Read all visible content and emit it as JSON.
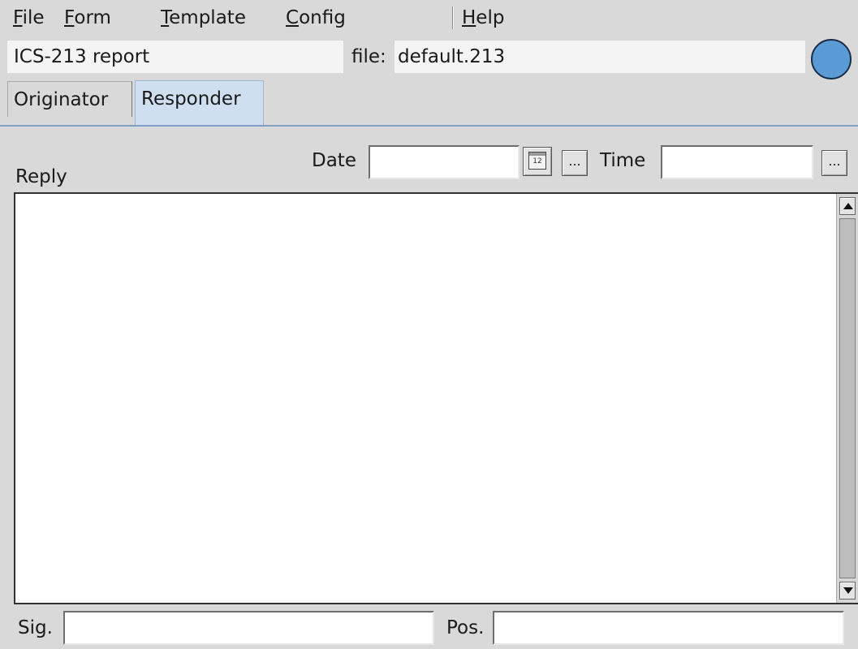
{
  "menu": {
    "file": {
      "underline": "F",
      "rest": "ile"
    },
    "form": {
      "underline": "F",
      "rest": "orm"
    },
    "template": {
      "underline": "T",
      "rest": "emplate"
    },
    "config": {
      "underline": "C",
      "rest": "onfig"
    },
    "help": {
      "underline": "H",
      "rest": "elp"
    }
  },
  "header": {
    "report_title": "ICS-213 report",
    "file_label": "file:",
    "file_name": "default.213",
    "status_light_color": "#5b9bd5"
  },
  "tabs": {
    "originator": "Originator",
    "responder": "Responder",
    "active": "Responder"
  },
  "responder": {
    "date_label": "Date",
    "date_value": "",
    "calendar_day": "12",
    "date_more": "...",
    "time_label": "Time",
    "time_value": "",
    "time_more": "...",
    "reply_label": "Reply",
    "reply_text": "",
    "sig_label": "Sig.",
    "sig_value": "",
    "pos_label": "Pos.",
    "pos_value": ""
  }
}
